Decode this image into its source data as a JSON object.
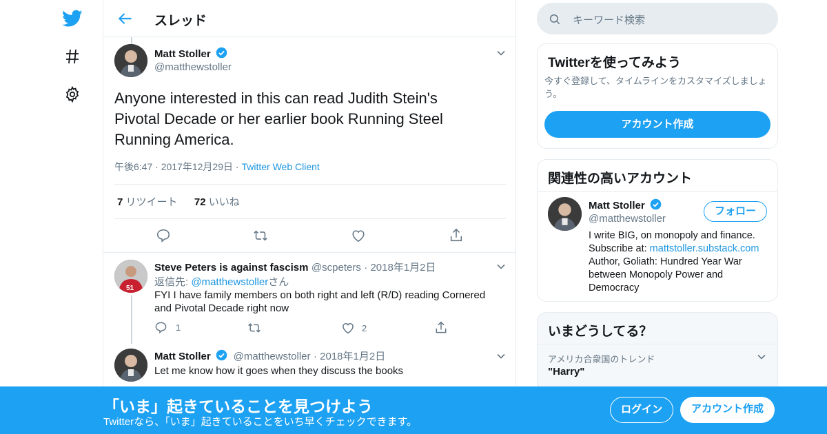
{
  "colors": {
    "accent": "#1da1f2",
    "link": "#1b95e0",
    "muted": "#657786",
    "border": "#e6ecf0"
  },
  "nav": {
    "icons": [
      "twitter-bird-icon",
      "hashtag-icon",
      "gear-icon"
    ]
  },
  "header": {
    "title": "スレッド"
  },
  "main_tweet": {
    "name": "Matt Stoller",
    "handle": "@matthewstoller",
    "text": "Anyone interested in this can read Judith Stein's Pivotal Decade or her earlier book Running Steel Running America.",
    "time": "午後6:47",
    "date": "2017年12月29日",
    "client": "Twitter Web Client",
    "retweets_count": "7",
    "retweets_label": "リツイート",
    "likes_count": "72",
    "likes_label": "いいね"
  },
  "replies": [
    {
      "name": "Steve Peters is against fascism",
      "handle": "@scpeters",
      "date": "2018年1月2日",
      "reply_to_prefix": "返信先: ",
      "reply_to_handle": "@matthewstoller",
      "reply_to_suffix": "さん",
      "text": "FYI I have family members on both right and left (R/D) reading Cornered and Pivotal Decade right now",
      "reply_count": "1",
      "like_count": "2"
    },
    {
      "name": "Matt Stoller",
      "handle": "@matthewstoller",
      "date": "2018年1月2日",
      "text": "Let me know how it goes when they discuss the books"
    }
  ],
  "sidebar": {
    "search_placeholder": "キーワード検索",
    "signup_card": {
      "title": "Twitterを使ってみよう",
      "description": "今すぐ登録して、タイムラインをカスタマイズしましょう。",
      "button": "アカウント作成"
    },
    "related_card": {
      "title": "関連性の高いアカウント",
      "name": "Matt Stoller",
      "handle": "@matthewstoller",
      "follow_button": "フォロー",
      "bio_line1": "I write BIG, on monopoly and finance.",
      "bio_subscribe": "Subscribe at: ",
      "bio_link": "mattstoller.substack.com",
      "bio_line3": "Author, Goliath: Hundred Year War between Monopoly Power and Democracy"
    },
    "trends_card": {
      "title": "いまどうしてる？",
      "context": "アメリカ合衆国のトレンド",
      "trend": "\"Harry\""
    }
  },
  "banner": {
    "headline": "「いま」起きていることを見つけよう",
    "sub": "Twitterなら、「いま」起きていることをいち早くチェックできます。",
    "login": "ログイン",
    "signup": "アカウント作成"
  }
}
